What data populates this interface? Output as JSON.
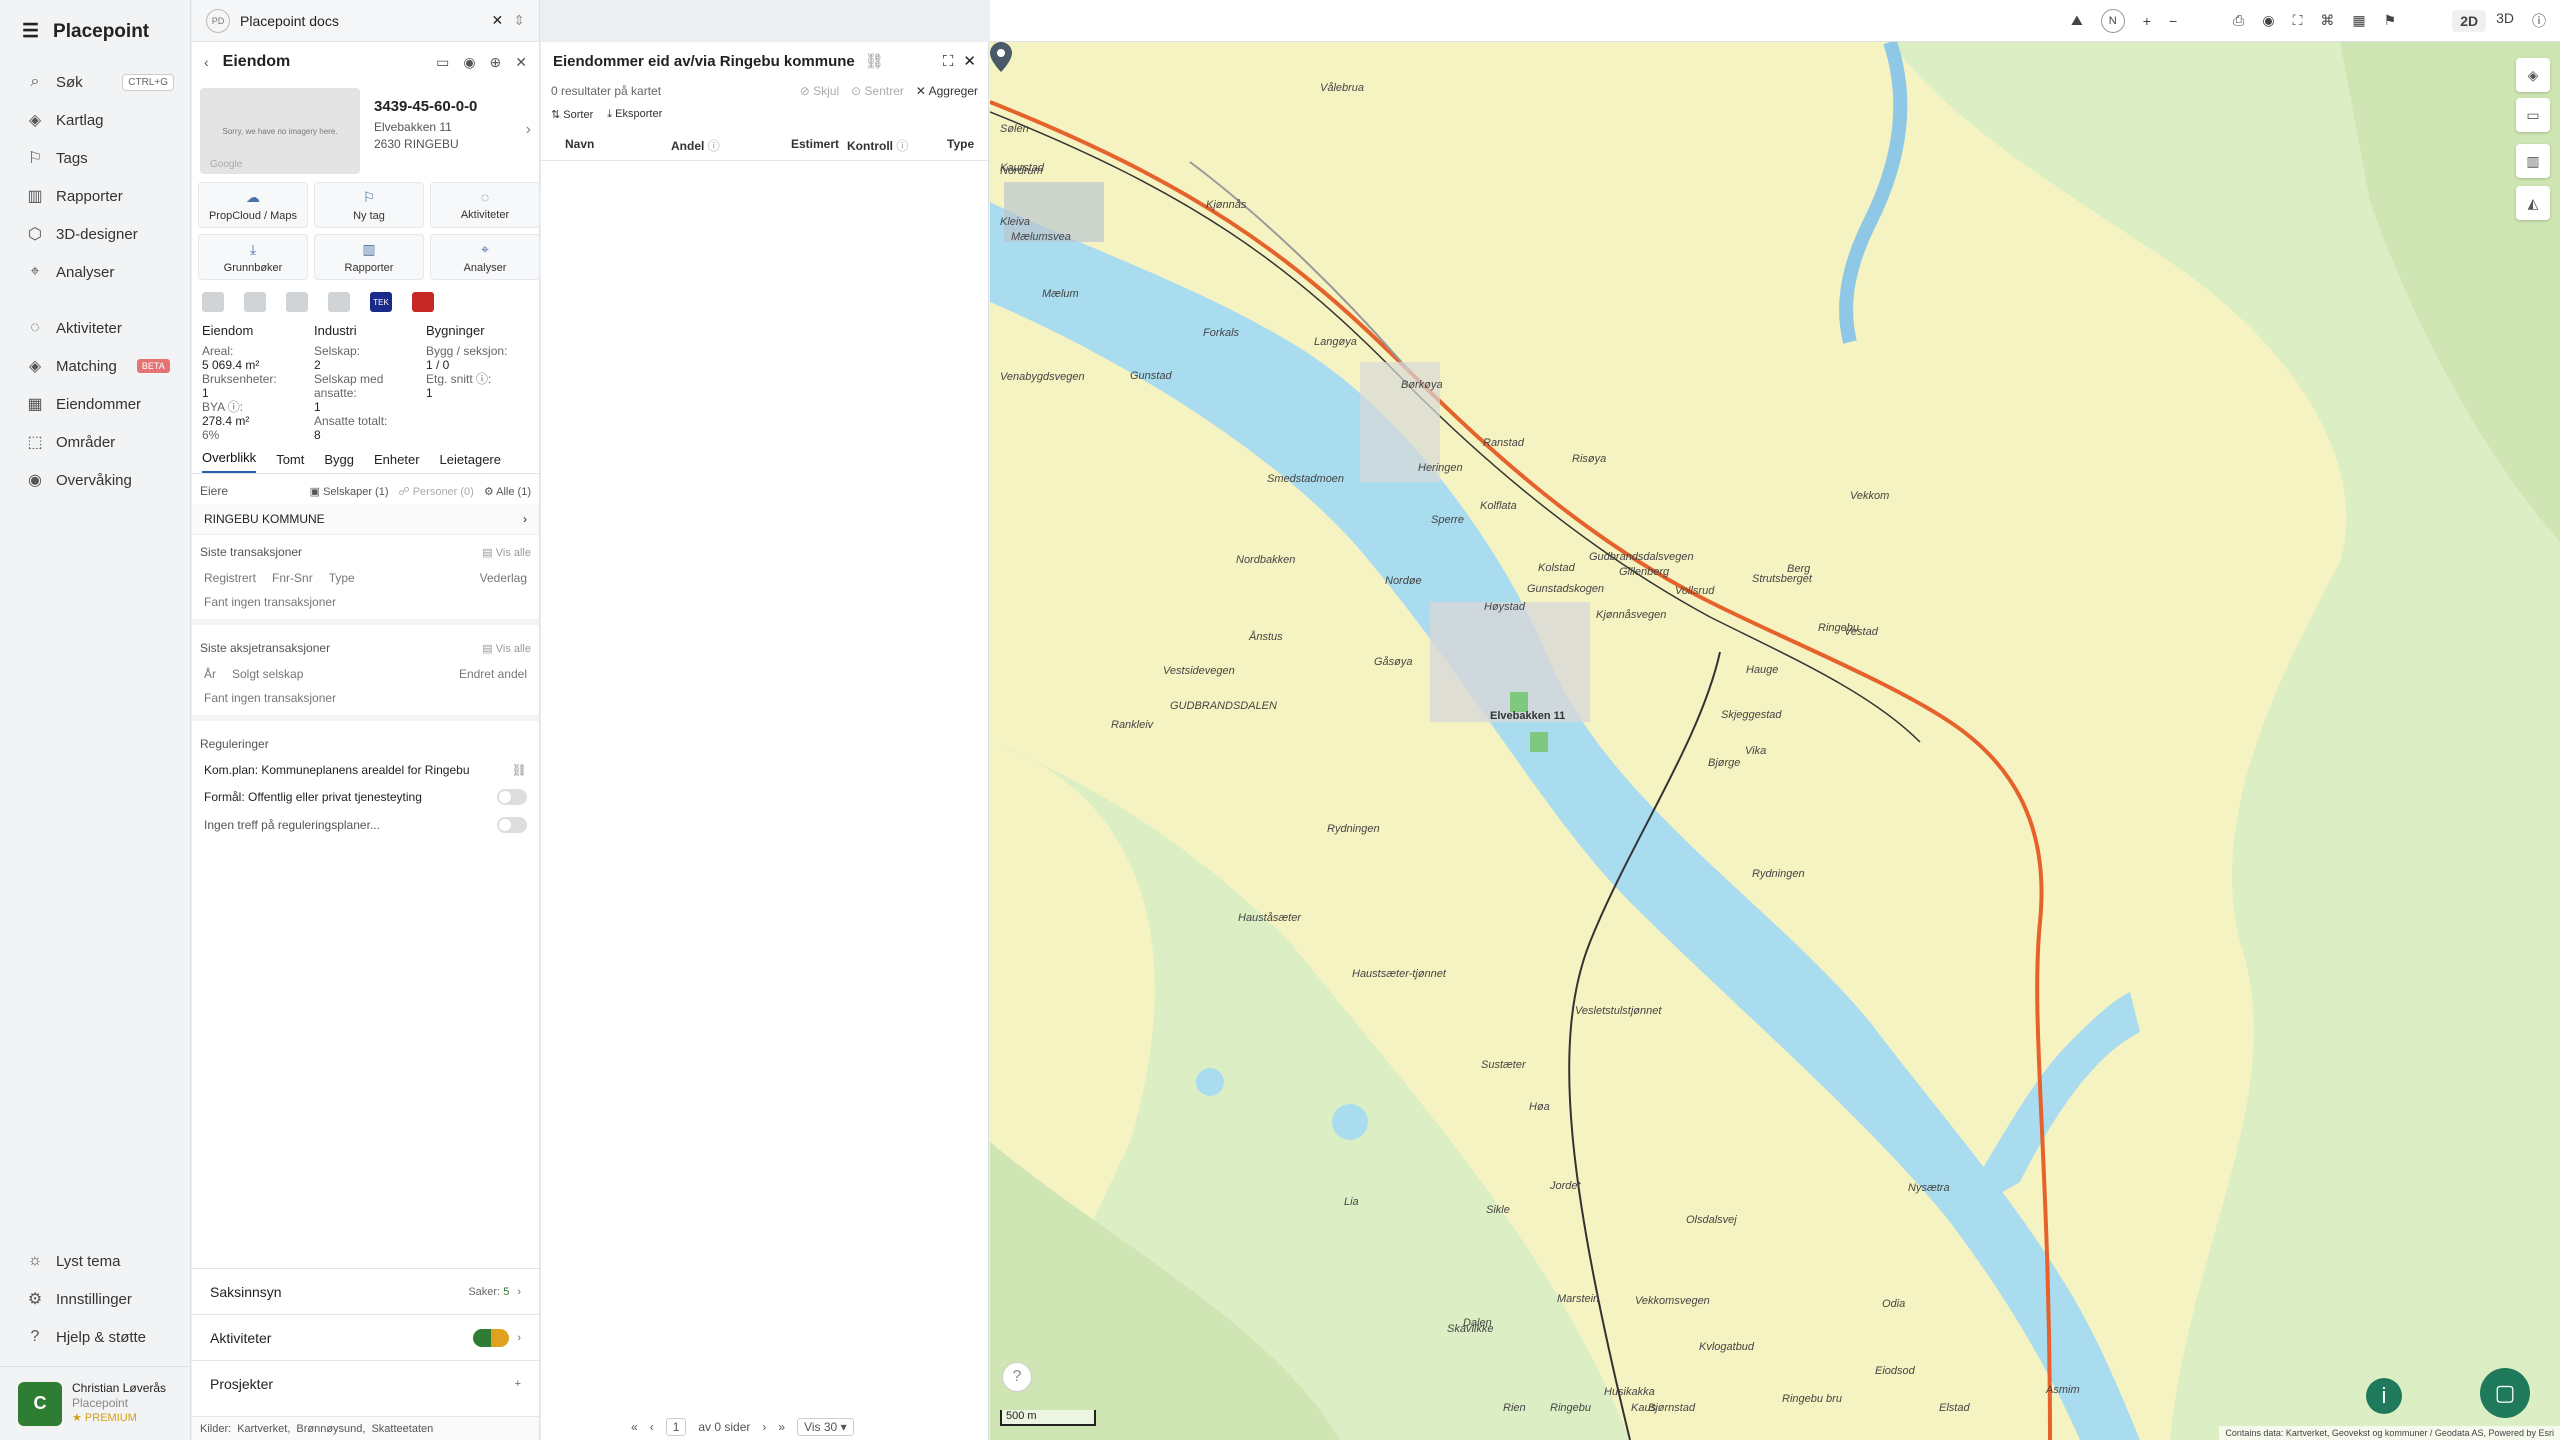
{
  "app": {
    "name": "Placepoint"
  },
  "nav": {
    "items": [
      {
        "label": "Søk",
        "icon": "search-icon",
        "kbd": "CTRL+G"
      },
      {
        "label": "Kartlag",
        "icon": "layers-icon"
      },
      {
        "label": "Tags",
        "icon": "bookmark-icon"
      },
      {
        "label": "Rapporter",
        "icon": "chart-icon"
      },
      {
        "label": "3D-designer",
        "icon": "cube-icon"
      },
      {
        "label": "Analyser",
        "icon": "pin-icon"
      }
    ],
    "items2": [
      {
        "label": "Aktiviteter",
        "icon": "chat-icon"
      },
      {
        "label": "Matching",
        "icon": "layers-icon",
        "badge": "BETA"
      },
      {
        "label": "Eiendommer",
        "icon": "building-icon"
      },
      {
        "label": "Områder",
        "icon": "area-icon"
      },
      {
        "label": "Overvåking",
        "icon": "eye-icon"
      }
    ],
    "bottom": [
      {
        "label": "Lyst tema",
        "icon": "sun-icon"
      },
      {
        "label": "Innstillinger",
        "icon": "gear-icon"
      },
      {
        "label": "Hjelp & støtte",
        "icon": "help-icon"
      }
    ],
    "user": {
      "initial": "C",
      "name": "Christian Løverås",
      "org": "Placepoint",
      "plan": "PREMIUM"
    }
  },
  "tab": {
    "badge": "PD",
    "title": "Placepoint docs"
  },
  "property": {
    "header": "Eiendom",
    "image_text": "Sorry, we have no imagery here.",
    "image_credit": "Google",
    "id": "3439-45-60-0-0",
    "street": "Elvebakken 11",
    "postal": "2630 RINGEBU"
  },
  "actions": [
    "PropCloud / Maps",
    "Ny tag",
    "Aktiviteter",
    "Grunnbøker",
    "Rapporter",
    "Analyser"
  ],
  "sources": [
    "",
    "",
    "",
    "",
    "TEK",
    ""
  ],
  "stats": {
    "col1": {
      "head": "Eiendom",
      "areal_l": "Areal:",
      "areal_v": "5 069.4 m²",
      "bruk_l": "Bruksenheter:",
      "bruk_v": "1",
      "bya_l": "BYA ⓘ:",
      "bya_v": "278.4 m²",
      "bya_p": "6%"
    },
    "col2": {
      "head": "Industri",
      "selskap_l": "Selskap:",
      "selskap_v": "2",
      "ansatte_l": "Selskap med ansatte:",
      "ansatte_v": "1",
      "tot_l": "Ansatte totalt:",
      "tot_v": "8"
    },
    "col3": {
      "head": "Bygninger",
      "bygg_l": "Bygg / seksjon:",
      "bygg_v": "1 / 0",
      "etg_l": "Etg. snitt ⓘ:",
      "etg_v": "1"
    }
  },
  "subtabs": [
    "Overblikk",
    "Tomt",
    "Bygg",
    "Enheter",
    "Leietagere"
  ],
  "owners": {
    "label": "Eiere",
    "f1": "Selskaper (1)",
    "f2": "Personer (0)",
    "f3": "Alle (1)",
    "name": "RINGEBU KOMMUNE"
  },
  "transactions": {
    "title": "Siste transaksjoner",
    "show_all": "Vis alle",
    "cols": [
      "Registrert",
      "Fnr-Snr",
      "Type",
      "Vederlag"
    ],
    "empty": "Fant ingen transaksjoner"
  },
  "share_tx": {
    "title": "Siste aksjetransaksjoner",
    "show_all": "Vis alle",
    "cols": [
      "År",
      "Solgt selskap",
      "Endret andel"
    ],
    "empty": "Fant ingen transaksjoner"
  },
  "regulations": {
    "title": "Reguleringer",
    "plan": "Kom.plan: Kommuneplanens arealdel for Ringebu",
    "purpose": "Formål: Offentlig eller privat tjenesteyting",
    "none": "Ingen treff på reguleringsplaner..."
  },
  "accordions": {
    "cases": "Saksinnsyn",
    "cases_count_l": "Saker:",
    "cases_count": "5",
    "activities": "Aktiviteter",
    "projects": "Prosjekter"
  },
  "footer": {
    "label": "Kilder:",
    "s1": "Kartverket,",
    "s2": "Brønnøysund,",
    "s3": "Skatteetaten"
  },
  "owned": {
    "title": "Eiendommer eid av/via Ringebu kommune",
    "results": "0 resultater på kartet",
    "hide": "Skjul",
    "center": "Sentrer",
    "aggregate": "Aggreger",
    "sort": "Sorter",
    "export": "Eksporter",
    "cols": [
      "Navn",
      "Andel",
      "Estimert",
      "Kontroll",
      "Type"
    ],
    "page": "1",
    "of_pages": "av 0 sider",
    "per_page": "Vis 30"
  },
  "topbar": {
    "mode2d": "2D",
    "mode3d": "3D",
    "north": "N"
  },
  "map": {
    "scale": "500 m",
    "attribution": "Contains data: Kartverket, Geovekst og kommuner / Geodata AS, Powered by Esri",
    "marker_label": "Elvebakken 11",
    "labels": [
      "Vålebrua",
      "Sølen",
      "Kleiva",
      "Mælumsvea",
      "Kaurstad",
      "Nordrum",
      "Mælum",
      "Venabygdsvegen",
      "Kjønnås",
      "Forkals",
      "Gunstad",
      "Smedstadmoen",
      "Langøya",
      "Børkøya",
      "Heringen",
      "Nordøe",
      "Risøya",
      "Gudbrandsdalsvegen",
      "Kjønnåsvegen",
      "Ranstad",
      "Kolflata",
      "Gunstadskogen",
      "Høystad",
      "Sperre",
      "Kolstad",
      "Vollsrud",
      "Strutsberget",
      "Gillenberg",
      "Hauge",
      "Bjørge",
      "Vekkom",
      "Berg",
      "Vestad",
      "Skjeggestad",
      "Ringebu",
      "Vika",
      "Rydningen",
      "Ånstus",
      "Nordbakken",
      "Vestsidevegen",
      "GUDBRANDSDALEN",
      "Rydningen",
      "Gåsøya",
      "Rankleiv",
      "Hauståsæter",
      "Vesletstulstjønnet",
      "Haustsæter-tjønnet",
      "Høa",
      "Olsdalsvej",
      "Dalen",
      "Jordet",
      "Marstein",
      "Lia",
      "Sustæter",
      "Nysætra",
      "Vekkomsvegen",
      "Ringebu bru",
      "Kvlogatbud",
      "Sikle",
      "Rien",
      "Ringebu",
      "Skavlikke",
      "Husikakka",
      "Kaus",
      "Bjørnstad",
      "Eiodsod",
      "Odia",
      "Elstad",
      "Asmim"
    ]
  }
}
